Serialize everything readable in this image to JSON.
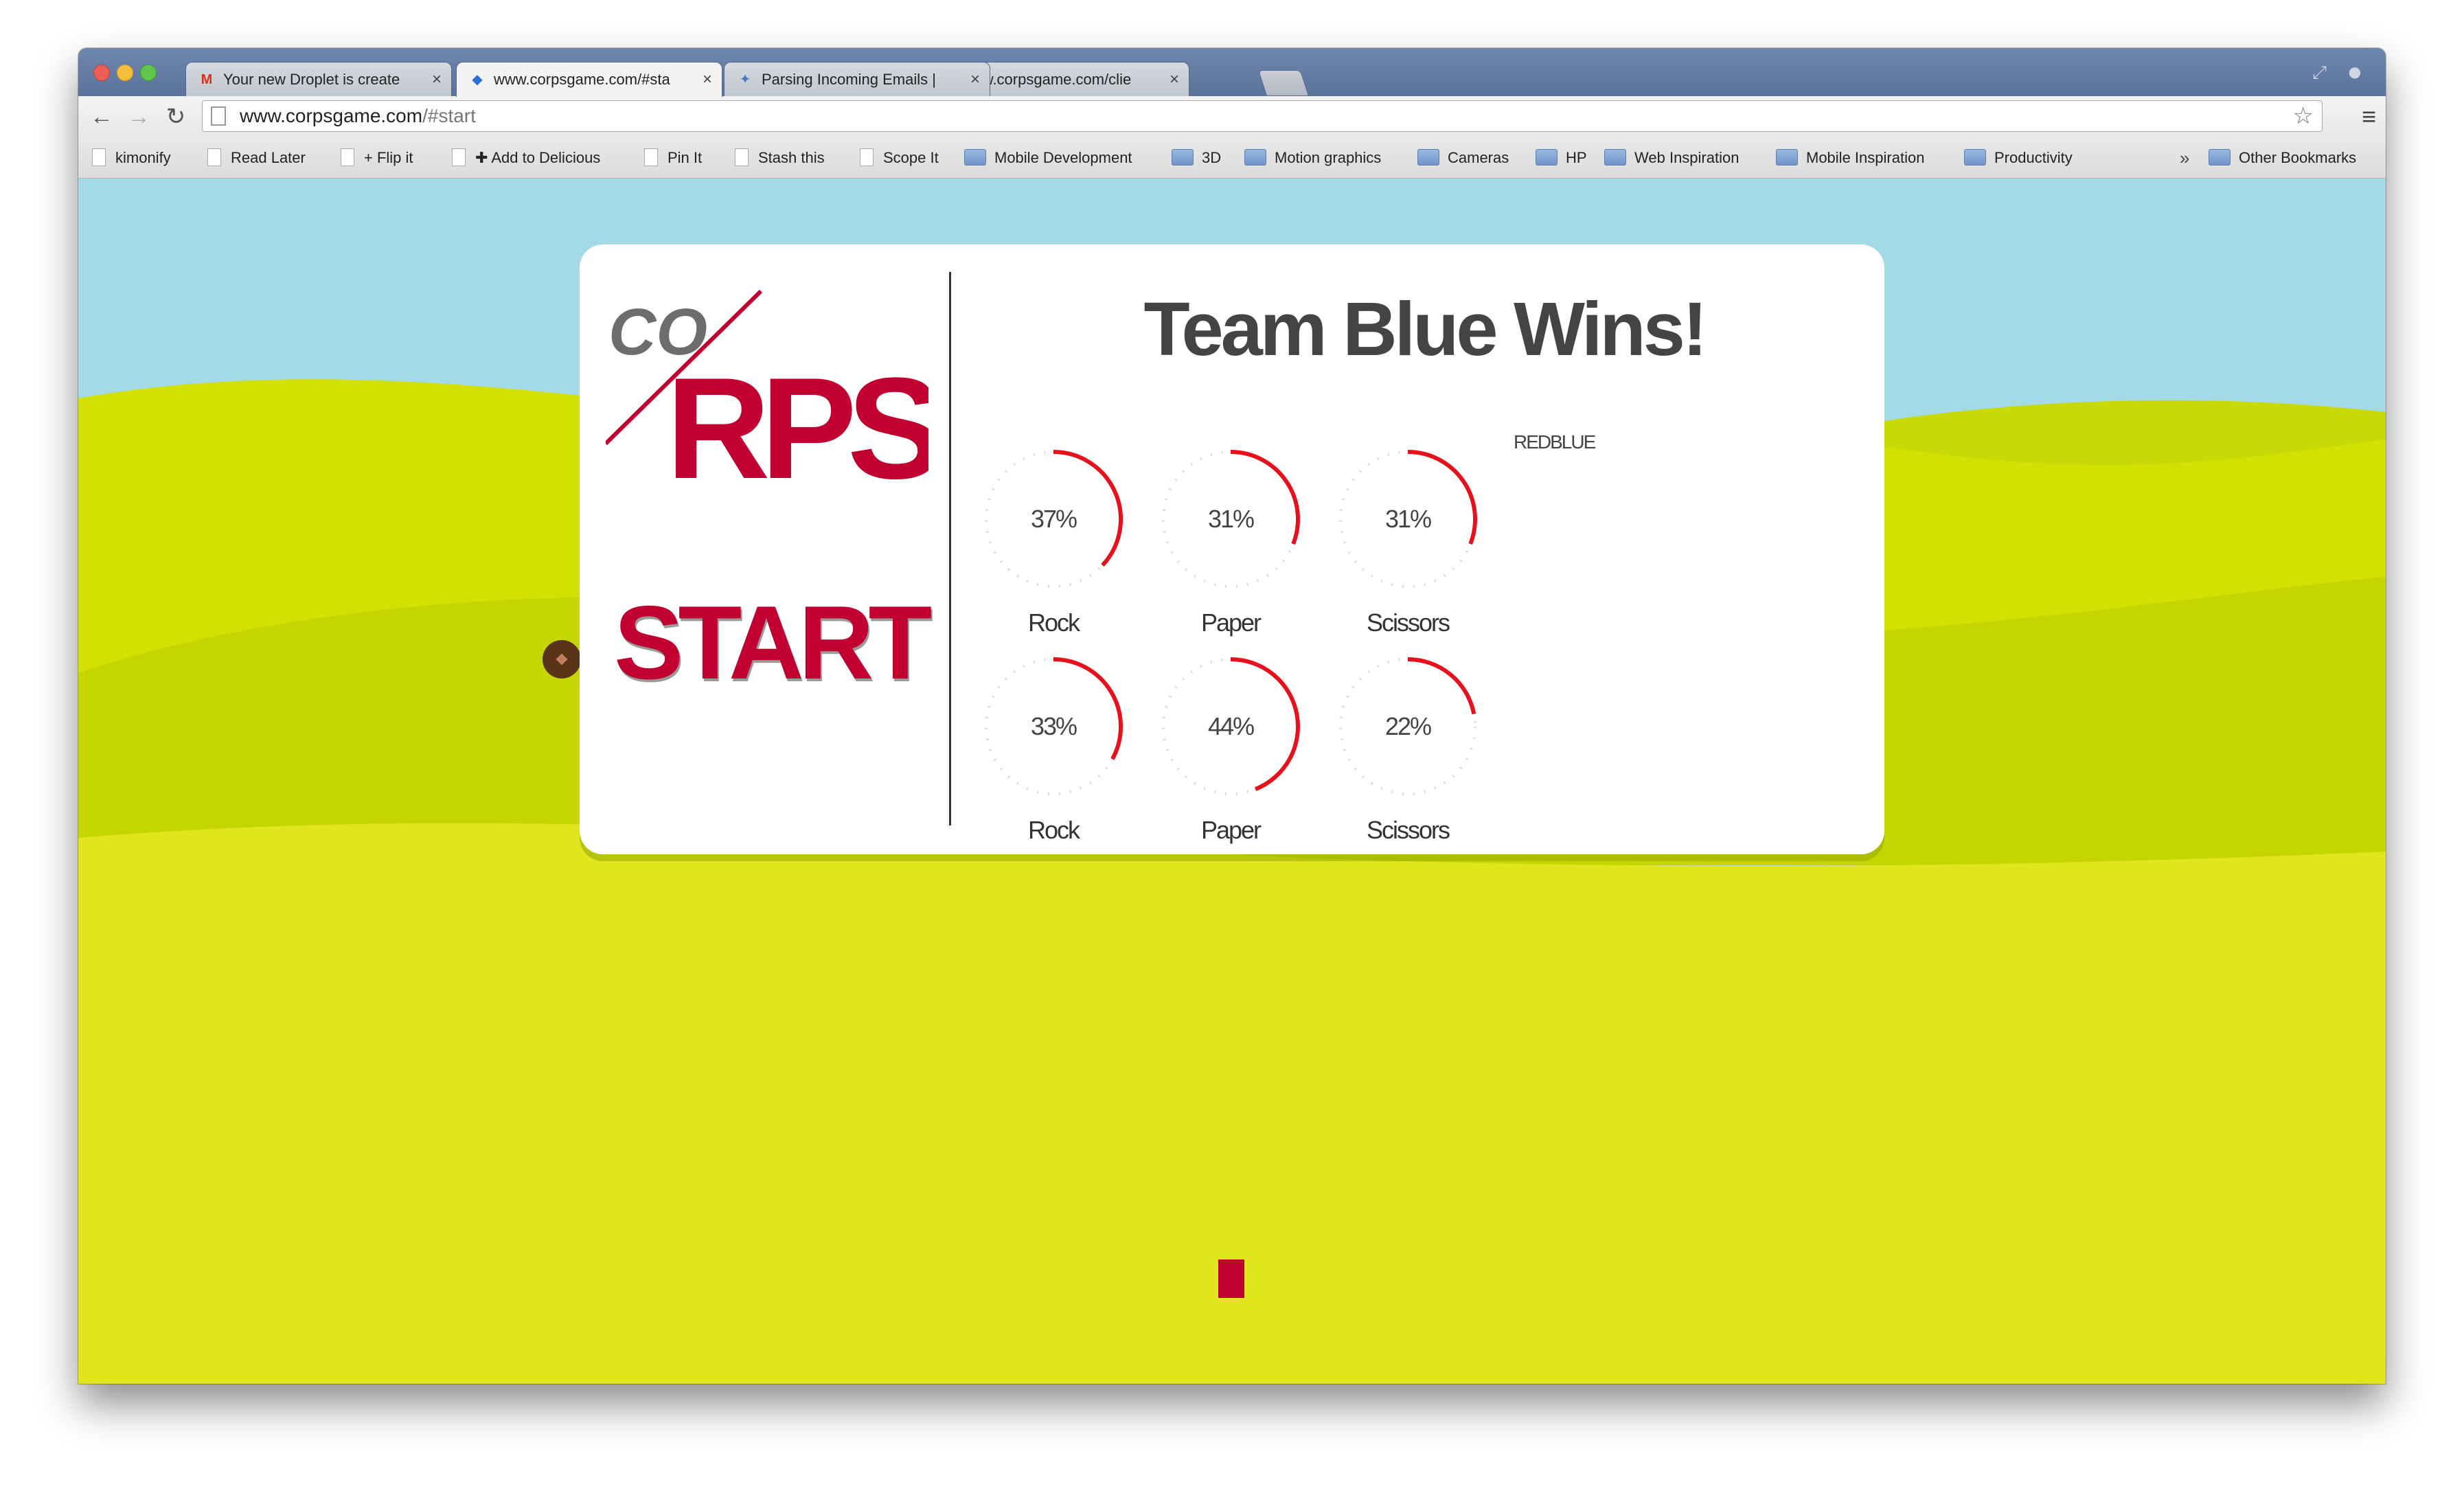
{
  "browser": {
    "tabs": [
      {
        "title": "Your new Droplet is create",
        "icon": "gmail-icon",
        "active": false
      },
      {
        "title": "www.corpsgame.com/#sta",
        "icon": "code-icon",
        "active": true
      },
      {
        "title": "Parsing Incoming Emails |",
        "icon": "puzzle-icon",
        "active": false
      },
      {
        "title": "www.corpsgame.com/clie",
        "icon": "code-icon",
        "active": false
      }
    ],
    "url_host": "www.corpsgame.com",
    "url_path": "/#start",
    "bookmarks": [
      {
        "label": "kimonify",
        "type": "page"
      },
      {
        "label": "Read Later",
        "type": "page"
      },
      {
        "label": "+ Flip it",
        "type": "page"
      },
      {
        "label": "✚ Add to Delicious",
        "type": "page"
      },
      {
        "label": "Pin It",
        "type": "page"
      },
      {
        "label": "Stash this",
        "type": "page"
      },
      {
        "label": "Scope It",
        "type": "page"
      },
      {
        "label": "Mobile Development",
        "type": "folder"
      },
      {
        "label": "3D",
        "type": "folder"
      },
      {
        "label": "Motion graphics",
        "type": "folder"
      },
      {
        "label": "Cameras",
        "type": "folder"
      },
      {
        "label": "HP",
        "type": "folder"
      },
      {
        "label": "Web Inspiration",
        "type": "folder"
      },
      {
        "label": "Mobile Inspiration",
        "type": "folder"
      },
      {
        "label": "Productivity",
        "type": "folder"
      }
    ],
    "bookmarks_overflow": "»",
    "other_bookmarks": "Other Bookmarks"
  },
  "game": {
    "logo_co": "CO",
    "logo_rps": "RPS",
    "start_label": "START",
    "headline": "Team Blue Wins!",
    "legend": "REDBLUE",
    "accent_color": "#e8101c",
    "brand_color": "#c2002f",
    "gauges": [
      {
        "value": "37%",
        "percent": 37,
        "label": "Rock"
      },
      {
        "value": "31%",
        "percent": 31,
        "label": "Paper"
      },
      {
        "value": "31%",
        "percent": 31,
        "label": "Scissors"
      },
      {
        "value": "33%",
        "percent": 33,
        "label": "Rock"
      },
      {
        "value": "44%",
        "percent": 44,
        "label": "Paper"
      },
      {
        "value": "22%",
        "percent": 22,
        "label": "Scissors"
      }
    ]
  }
}
